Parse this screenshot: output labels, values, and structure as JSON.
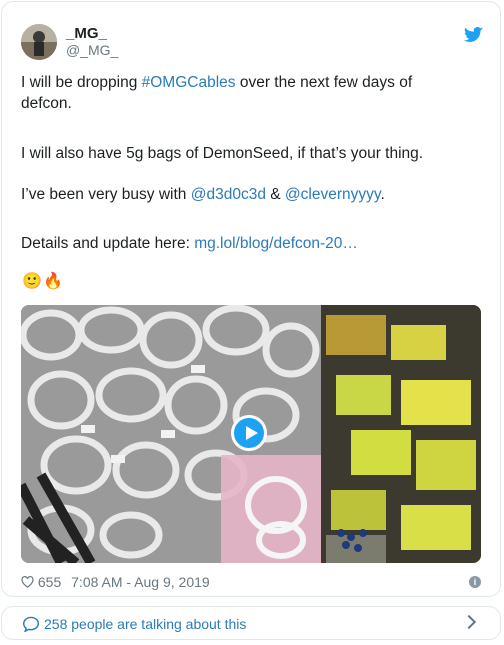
{
  "author": {
    "name": "_MG_",
    "handle": "@_MG_"
  },
  "tweet": {
    "line1_pre": "I will be dropping ",
    "line1_hashtag": "#OMGCables",
    "line1_post": " over the next few days of",
    "line2": "defcon.",
    "line3": "I will also have 5g bags of DemonSeed, if that’s your thing.",
    "line4_pre": "I’ve been very busy with ",
    "line4_mention1": "@d3d0c3d",
    "line4_mid": " & ",
    "line4_mention2": "@clevernyyyy",
    "line4_post": ".",
    "line5_pre": "Details and update here: ",
    "line5_link": "mg.lol/blog/defcon-20…",
    "emoji": [
      "🙂",
      "🔥"
    ]
  },
  "meta": {
    "likes": "655",
    "timestamp": "7:08 AM - Aug 9, 2019"
  },
  "footer": {
    "text": "258 people are talking about this"
  },
  "colors": {
    "link": "#2b7bb9",
    "twitter_blue": "#1da1f2",
    "border": "#e1e8ed"
  },
  "icons": [
    "avatar",
    "twitter-bird-icon",
    "play-icon",
    "heart-icon",
    "info-icon",
    "chevron-right-icon",
    "comments-icon"
  ]
}
